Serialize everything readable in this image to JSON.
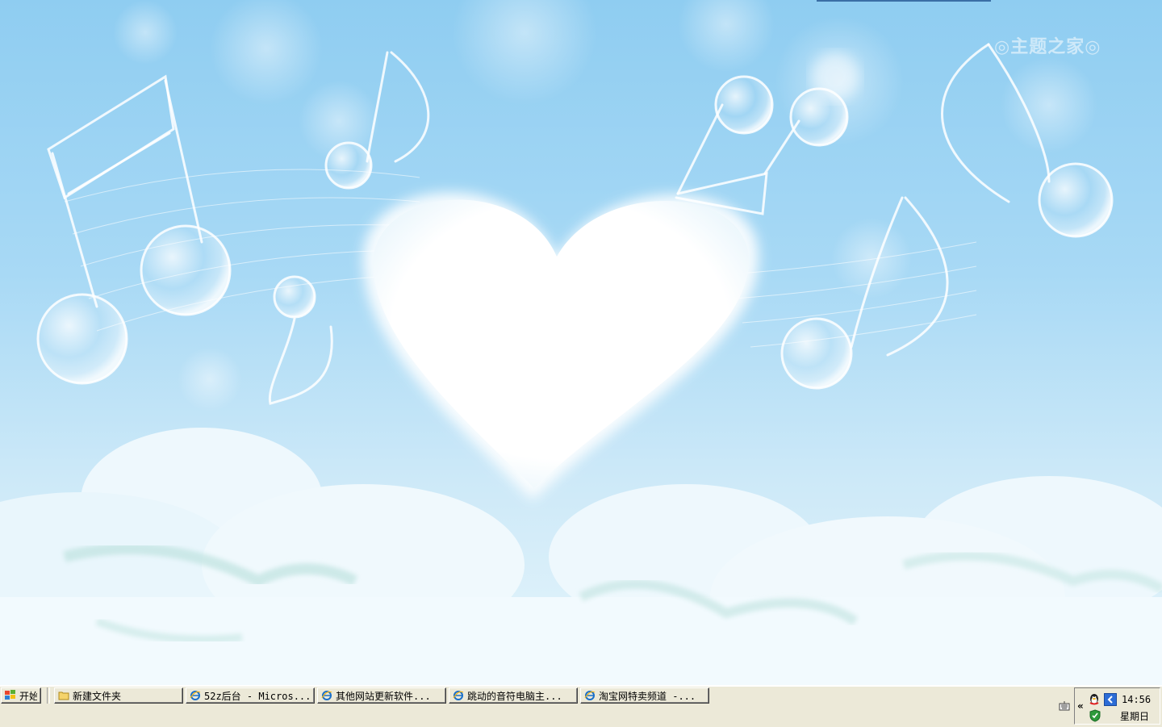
{
  "wallpaper": {
    "watermark": "◎主题之家◎",
    "sky_color": "#8fcdf1"
  },
  "taskbar": {
    "start_label": "开始",
    "tasks": [
      {
        "label": "新建文件夹",
        "icon": "folder-icon"
      },
      {
        "label": "52z后台 - Micros...",
        "icon": "ie-icon"
      },
      {
        "label": "其他网站更新软件...",
        "icon": "ie-icon"
      },
      {
        "label": "跳动的音符电脑主...",
        "icon": "ie-icon"
      },
      {
        "label": "淘宝网特卖频道 -...",
        "icon": "ie-icon"
      }
    ],
    "tray": {
      "expand_label": "«",
      "icons": [
        "keyboard-icon",
        "qq-icon",
        "language-icon",
        "shield-icon"
      ],
      "time": "14:56",
      "day": "星期日"
    }
  }
}
